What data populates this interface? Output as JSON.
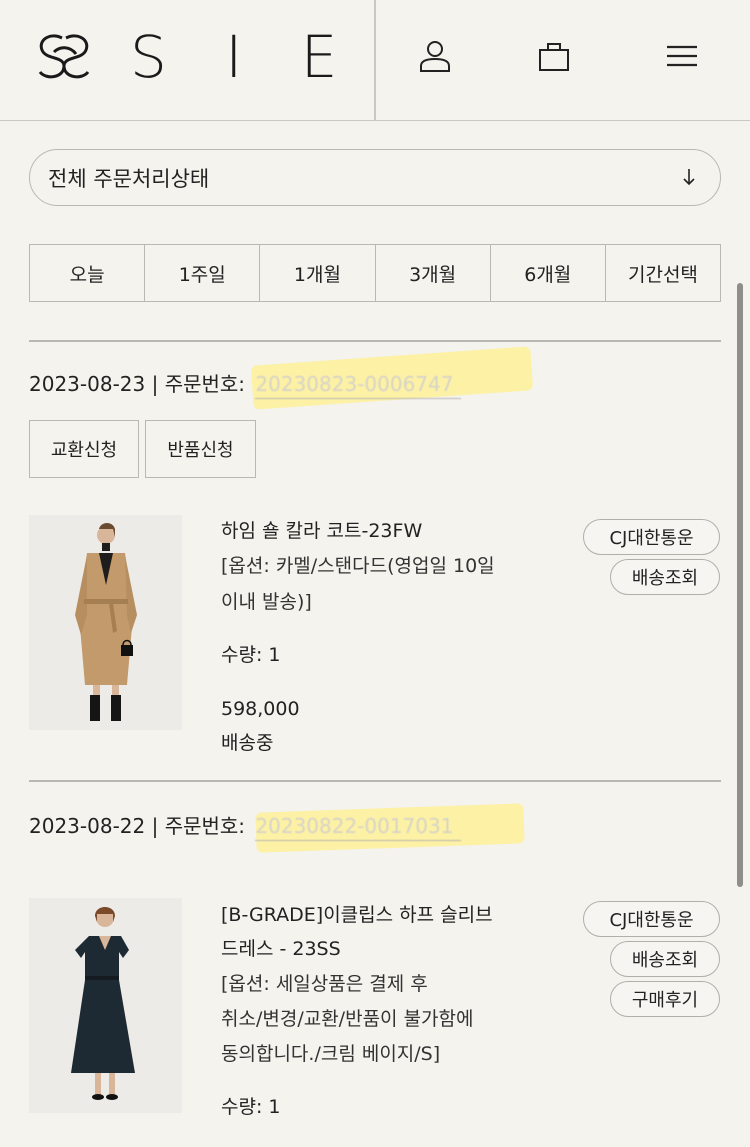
{
  "header": {
    "brand": "S I E",
    "icons": [
      "user-icon",
      "bag-icon",
      "menu-icon"
    ]
  },
  "filter": {
    "status_label": "전체 주문처리상태",
    "periods": [
      "오늘",
      "1주일",
      "1개월",
      "3개월",
      "6개월",
      "기간선택"
    ]
  },
  "orders": [
    {
      "date": "2023-08-23",
      "order_label": "| 주문번호:",
      "order_number": "20230823-0006747",
      "actions": [
        "교환신청",
        "반품신청"
      ],
      "product": {
        "name": "하임 숄 칼라 코트-23FW",
        "option_lines": [
          "[옵션: 카멜/스탠다드(영업일 10일",
          "이내 발송)]"
        ],
        "quantity": "수량: 1",
        "price": "598,000",
        "status": "배송중"
      },
      "buttons": [
        "CJ대한통운",
        "배송조회"
      ]
    },
    {
      "date": "2023-08-22",
      "order_label": "| 주문번호:",
      "order_number": "20230822-0017031",
      "product": {
        "name_lines": [
          "[B-GRADE]이클립스 하프 슬리브",
          "드레스 - 23SS"
        ],
        "option_lines": [
          "[옵션: 세일상품은 결제 후",
          "취소/변경/교환/반품이 불가함에",
          "동의합니다./크림 베이지/S]"
        ],
        "quantity": "수량: 1"
      },
      "buttons": [
        "CJ대한통운",
        "배송조회",
        "구매후기"
      ]
    }
  ],
  "colors": {
    "background": "#f4f3ee",
    "border": "#b9b8b3",
    "highlight": "#fff08c"
  }
}
